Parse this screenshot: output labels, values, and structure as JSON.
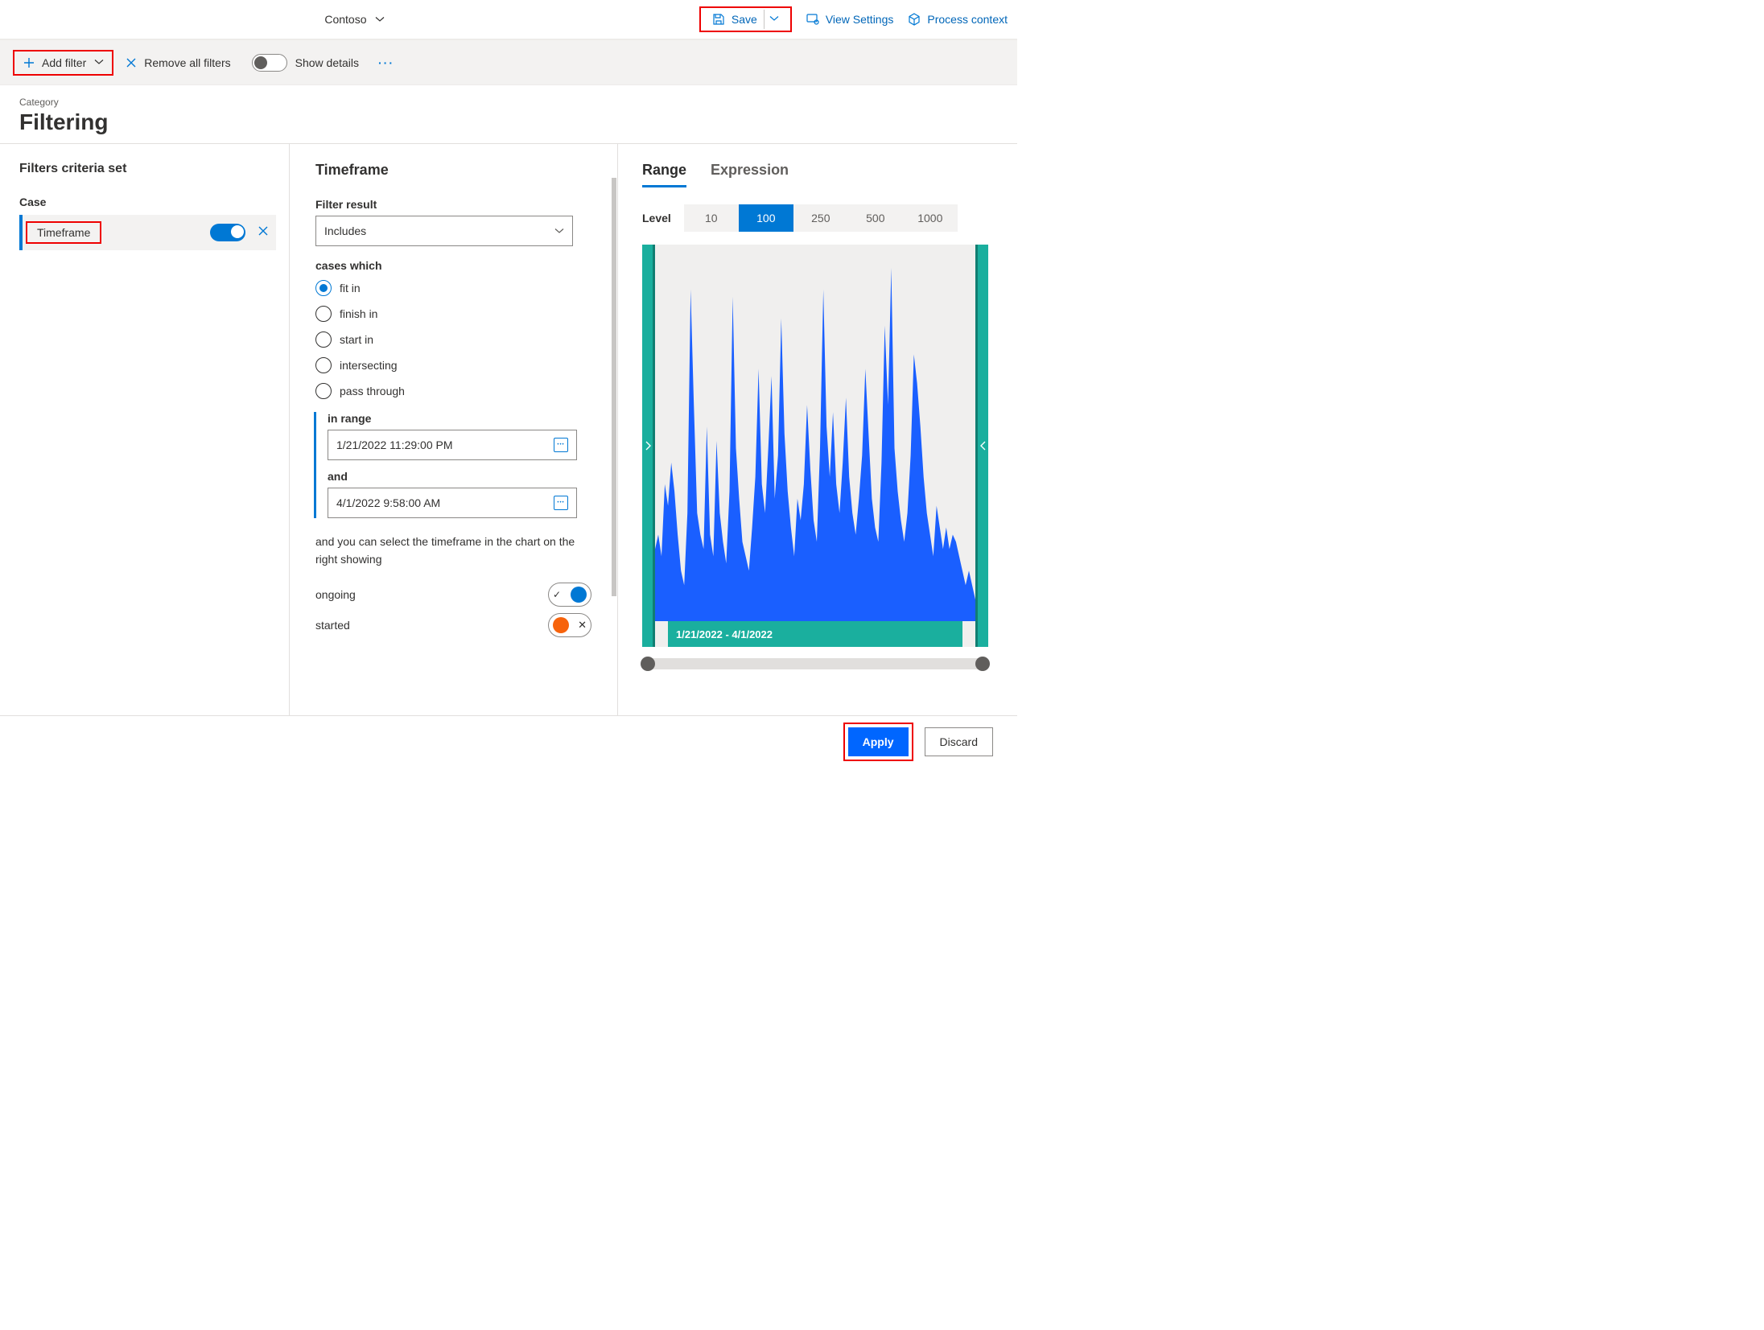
{
  "top": {
    "tenant": "Contoso",
    "save_label": "Save",
    "view_settings": "View Settings",
    "process_context": "Process context"
  },
  "toolbar": {
    "add_filter": "Add filter",
    "remove_all": "Remove all filters",
    "show_details": "Show details",
    "more": "···"
  },
  "page": {
    "category": "Category",
    "title": "Filtering"
  },
  "left": {
    "title": "Filters criteria set",
    "group": "Case",
    "item": "Timeframe"
  },
  "mid": {
    "title": "Timeframe",
    "filter_result_label": "Filter result",
    "filter_result_value": "Includes",
    "cases_which": "cases which",
    "radios": {
      "fit_in": "fit in",
      "finish_in": "finish in",
      "start_in": "start in",
      "intersecting": "intersecting",
      "pass_through": "pass through"
    },
    "in_range": "in range",
    "from_value": "1/21/2022 11:29:00 PM",
    "and_label": "and",
    "to_value": "4/1/2022 9:58:00 AM",
    "helper": "and you can select the timeframe in the chart on the right showing",
    "ongoing": "ongoing",
    "started": "started"
  },
  "right": {
    "tab_range": "Range",
    "tab_expression": "Expression",
    "level_label": "Level",
    "levels": [
      "10",
      "100",
      "250",
      "500",
      "1000"
    ],
    "footer": "1/21/2022 - 4/1/2022"
  },
  "footer": {
    "apply": "Apply",
    "discard": "Discard"
  },
  "chart_data": {
    "type": "area",
    "title": "",
    "xlabel": "",
    "ylabel": "",
    "x_range": [
      "1/21/2022",
      "4/1/2022"
    ],
    "ylim": [
      0,
      100
    ],
    "values": [
      20,
      24,
      18,
      38,
      32,
      44,
      36,
      24,
      14,
      10,
      30,
      92,
      60,
      30,
      24,
      20,
      54,
      24,
      18,
      50,
      30,
      22,
      16,
      36,
      90,
      48,
      34,
      22,
      18,
      14,
      26,
      40,
      70,
      38,
      30,
      48,
      68,
      34,
      46,
      84,
      52,
      36,
      26,
      18,
      34,
      28,
      38,
      60,
      42,
      28,
      22,
      48,
      92,
      54,
      40,
      58,
      38,
      30,
      44,
      62,
      40,
      30,
      24,
      34,
      46,
      70,
      52,
      34,
      26,
      22,
      44,
      82,
      60,
      98,
      48,
      36,
      28,
      22,
      30,
      46,
      74,
      66,
      54,
      40,
      30,
      24,
      18,
      32,
      26,
      20,
      26,
      20,
      24,
      22,
      18,
      14,
      10,
      14,
      10,
      6
    ]
  }
}
